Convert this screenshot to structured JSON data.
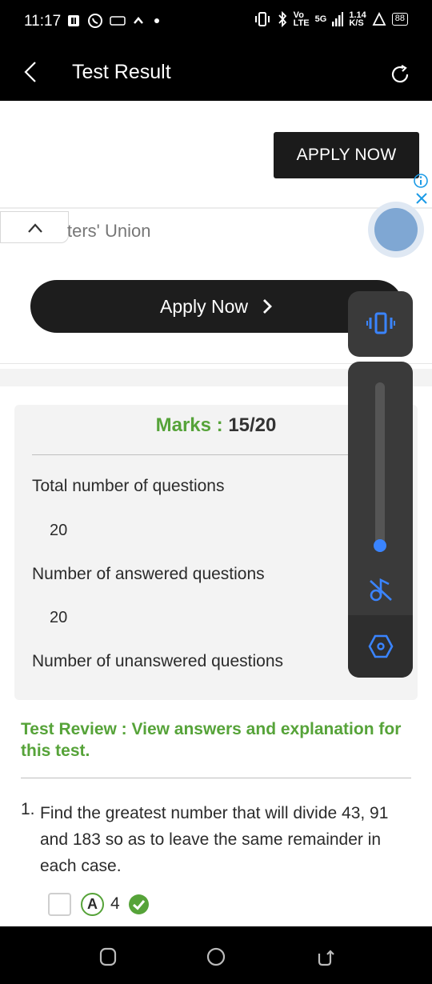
{
  "status_bar": {
    "time": "11:17",
    "network_label_top": "Vo",
    "network_label_bottom": "LTE",
    "net_gen": "5G",
    "speed_value": "1.14",
    "speed_unit": "K/S",
    "battery": "88"
  },
  "app_bar": {
    "title": "Test Result",
    "back_icon": "chevron-left-icon",
    "refresh_icon": "refresh-icon"
  },
  "ad": {
    "apply_top_label": "APPLY NOW",
    "sponsor_fragment": "ters' Union",
    "apply_big_label": "Apply Now"
  },
  "marks": {
    "label": "Marks : ",
    "value": "15/20"
  },
  "stats": [
    {
      "label": "Total number of questions",
      "value": "20"
    },
    {
      "label": "Number of answered questions",
      "value": "20"
    },
    {
      "label": "Number of unanswered questions"
    }
  ],
  "review": {
    "link_text": "Test Review : View answers and explanation for this test."
  },
  "question": {
    "number": "1.",
    "text": "Find the greatest number that will divide 43, 91 and 183 so as to leave the same remainder in each case.",
    "option_letter": "A",
    "option_text": "4"
  },
  "colors": {
    "accent_green": "#56a339",
    "bar_black": "#000000",
    "panel_grey": "#3a3a3a",
    "slider_blue": "#3a84ff",
    "ad_info_blue": "#1a9ae6"
  }
}
